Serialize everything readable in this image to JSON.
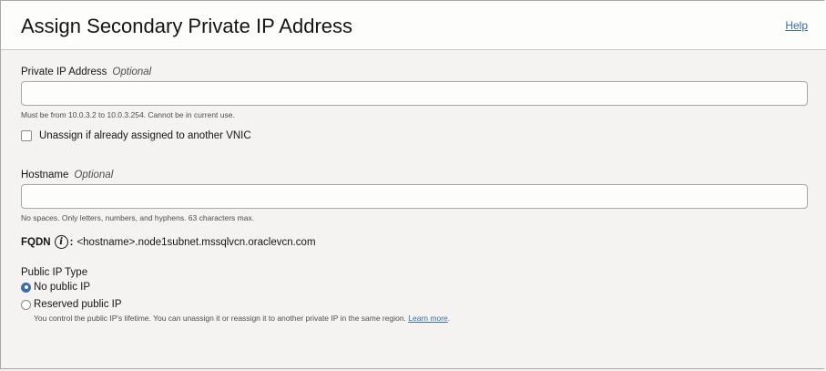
{
  "header": {
    "title": "Assign Secondary Private IP Address",
    "help_label": "Help"
  },
  "private_ip": {
    "label": "Private IP Address",
    "optional": "Optional",
    "value": "",
    "hint": "Must be from 10.0.3.2 to 10.0.3.254. Cannot be in current use."
  },
  "unassign": {
    "label": "Unassign if already assigned to another VNIC",
    "checked": false
  },
  "hostname": {
    "label": "Hostname",
    "optional": "Optional",
    "value": "",
    "hint": "No spaces. Only letters, numbers, and hyphens. 63 characters max."
  },
  "fqdn": {
    "label": "FQDN",
    "info_icon_glyph": "i",
    "colon": ":",
    "value": "<hostname>.node1subnet.mssqlvcn.oraclevcn.com"
  },
  "public_ip_type": {
    "label": "Public IP Type",
    "options": [
      {
        "label": "No public IP",
        "selected": true
      },
      {
        "label": "Reserved public IP",
        "selected": false
      }
    ],
    "reserved_description": "You control the public IP's lifetime. You can unassign it or reassign it to another private IP in the same region.",
    "learn_more_label": "Learn more",
    "trailing_period": "."
  },
  "colors": {
    "accent": "#3a6ca8",
    "background": "#f4f3f2",
    "header_background": "#fdfdfc",
    "text": "#161513"
  }
}
